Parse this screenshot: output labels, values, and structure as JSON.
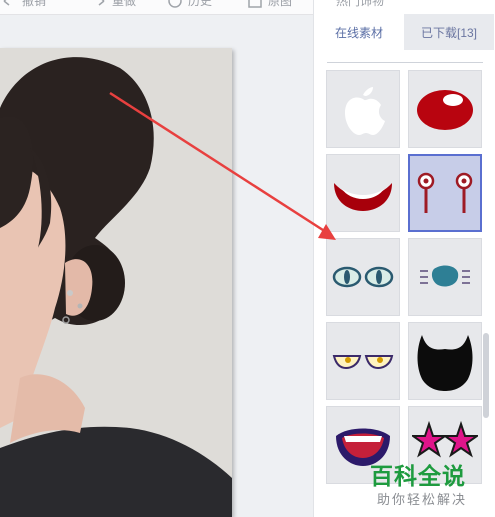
{
  "toolbar": {
    "items": [
      {
        "label": "撤销",
        "icon": "undo-icon"
      },
      {
        "label": "重做",
        "icon": "redo-icon"
      },
      {
        "label": "历史",
        "icon": "history-icon"
      },
      {
        "label": "原图",
        "icon": "original-image-icon"
      }
    ]
  },
  "panel": {
    "top_label": "热门饰物",
    "tabs": [
      {
        "label": "在线素材",
        "active": true
      },
      {
        "label": "已下载[13]",
        "active": false
      }
    ],
    "items": [
      {
        "icon": "apple-logo-icon",
        "selected": false
      },
      {
        "icon": "red-clown-nose-icon",
        "selected": false
      },
      {
        "icon": "red-smile-mouth-icon",
        "selected": false
      },
      {
        "icon": "hanging-eyes-icon",
        "selected": true
      },
      {
        "icon": "blue-cat-eyes-icon",
        "selected": false
      },
      {
        "icon": "blue-nose-whiskers-icon",
        "selected": false
      },
      {
        "icon": "sleepy-eyes-icon",
        "selected": false
      },
      {
        "icon": "black-beard-icon",
        "selected": false
      },
      {
        "icon": "purple-mouth-icon",
        "selected": false
      },
      {
        "icon": "star-glasses-icon",
        "selected": false
      }
    ]
  },
  "watermark": {
    "title": "百科全说",
    "subtitle": "助你轻松解决"
  },
  "colors": {
    "accent": "#5a6fd0",
    "arrow": "#e8403f",
    "watermark_green": "#1e9b3f"
  }
}
